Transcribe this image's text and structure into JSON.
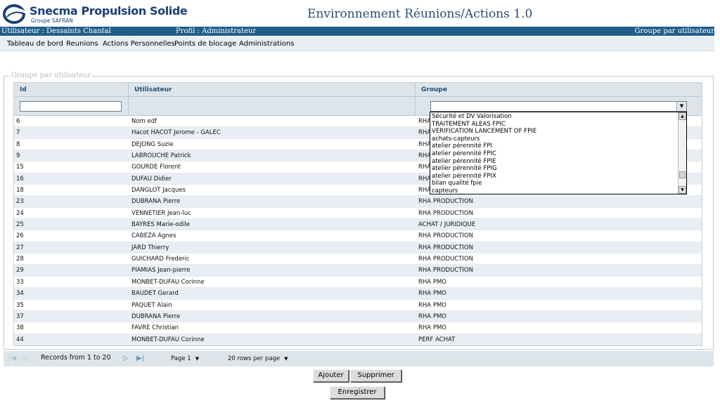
{
  "brand": {
    "name": "Snecma Propulsion Solide",
    "group": "Groupe SAFRAN",
    "accent": "#1b3f77"
  },
  "app_title": "Environnement Réunions/Actions 1.0",
  "userbar": {
    "user": "Utilisateur : Dessaints Chantal",
    "profile": "Profil : Administrateur",
    "page": "Groupe par utilisateur",
    "color": "#1f5e8b"
  },
  "menu": [
    "Tableau de bord",
    "Reunions",
    "Actions Personnelles",
    "Points de blocage",
    "Administrations"
  ],
  "groupbox_legend": "Groupe par utilisateur",
  "grid": {
    "columns": {
      "id": "Id",
      "user": "Utilisateur",
      "group": "Groupe"
    },
    "filters": {
      "id_value": "",
      "group_value": ""
    },
    "rows": [
      {
        "id": "6",
        "user": "Nom edf",
        "group": "RHA"
      },
      {
        "id": "7",
        "user": "Hacot HACOT Jerome - GALEC",
        "group": "RHA"
      },
      {
        "id": "8",
        "user": "DEJONG Suzie",
        "group": "RHA"
      },
      {
        "id": "9",
        "user": "LABROUCHE Patrick",
        "group": "RHA"
      },
      {
        "id": "15",
        "user": "GOURDE Florent",
        "group": "RHA"
      },
      {
        "id": "16",
        "user": "DUFAU Didier",
        "group": "RHA"
      },
      {
        "id": "18",
        "user": "DANGLOT Jacques",
        "group": "RHA"
      },
      {
        "id": "23",
        "user": "DUBRANA Pierre",
        "group": "RHA PRODUCTION"
      },
      {
        "id": "24",
        "user": "VENNETIER Jean-luc",
        "group": "RHA PRODUCTION"
      },
      {
        "id": "25",
        "user": "BAYRES Marie-odile",
        "group": "ACHAT / JURIDIQUE"
      },
      {
        "id": "26",
        "user": "CABEZA Agnes",
        "group": "RHA PRODUCTION"
      },
      {
        "id": "27",
        "user": "JARD Thierry",
        "group": "RHA PRODUCTION"
      },
      {
        "id": "28",
        "user": "GUICHARD Frederic",
        "group": "RHA PRODUCTION"
      },
      {
        "id": "29",
        "user": "PIAMIAS Jean-pierre",
        "group": "RHA PRODUCTION"
      },
      {
        "id": "33",
        "user": "MONBET-DUFAU Corinne",
        "group": "RHA PMO"
      },
      {
        "id": "34",
        "user": "BAUDET Gerard",
        "group": "RHA PMO"
      },
      {
        "id": "35",
        "user": "PAQUET Alain",
        "group": "RHA PMO"
      },
      {
        "id": "37",
        "user": "DUBRANA Pierre",
        "group": "RHA PMO"
      },
      {
        "id": "38",
        "user": "FAVRE Christian",
        "group": "RHA PMO"
      },
      {
        "id": "44",
        "user": "MONBET-DUFAU Corinne",
        "group": "PERF ACHAT"
      }
    ]
  },
  "dropdown_options": [
    "Sécurité et DV  Valorisation",
    "TRAITEMENT ALEAS FPIC",
    "VERIFICATION LANCEMENT OF FPIE",
    "achats-capteurs",
    "atelier pérennité FPI",
    "atelier pérennité FPIC",
    "atelier pérennité FPIE",
    "atelier pérennité FPIG",
    "atelier pérennité FPIX",
    "bilan qualité fpie",
    "capteurs"
  ],
  "pager": {
    "records": "Records from 1 to 20",
    "page": "Page 1",
    "rows_per_page": "20 rows per page"
  },
  "buttons": {
    "add": "Ajouter",
    "delete": "Supprimer",
    "save": "Enregistrer"
  },
  "icons": {
    "first": "first-page-icon",
    "prev": "previous-page-icon",
    "next": "next-page-icon",
    "last": "last-page-icon",
    "dropdown": "chevron-down-icon"
  }
}
